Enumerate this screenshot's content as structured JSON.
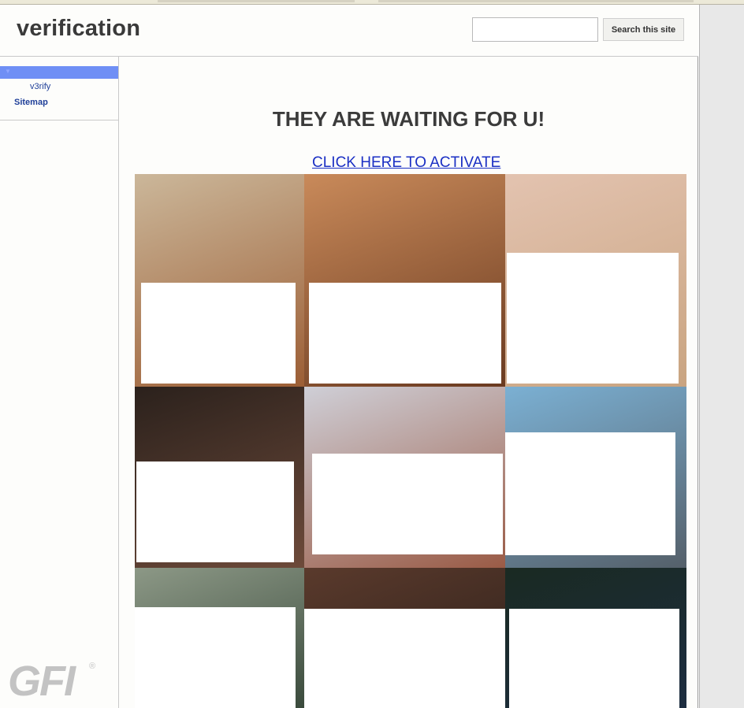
{
  "browser": {
    "tab_hint": ""
  },
  "header": {
    "site_title": "verification",
    "search_placeholder": "",
    "search_button": "Search this site"
  },
  "sidebar": {
    "items": [
      {
        "label": "v3rify"
      },
      {
        "label": "Sitemap"
      }
    ],
    "brand_text": "GFI",
    "brand_mark": "®"
  },
  "main": {
    "headline": "THEY ARE WAITING FOR U!",
    "activate_link": "CLICK HERE TO ACTIVATE"
  },
  "gallery": {
    "tiles": [
      {
        "name": "photo-tile-1",
        "top": "#cbb79a",
        "bottom": "#9c5e35"
      },
      {
        "name": "photo-tile-2",
        "top": "#c98a5a",
        "bottom": "#6a3a20"
      },
      {
        "name": "photo-tile-3",
        "top": "#e3c3b0",
        "bottom": "#c9a480"
      },
      {
        "name": "photo-tile-4",
        "top": "#2b211c",
        "bottom": "#6d4a3a"
      },
      {
        "name": "photo-tile-5",
        "top": "#cfcfd7",
        "bottom": "#9a5b46"
      },
      {
        "name": "photo-tile-6",
        "top": "#7bb0d3",
        "bottom": "#55606a"
      },
      {
        "name": "photo-tile-7",
        "top": "#8c9886",
        "bottom": "#3a4a3c"
      },
      {
        "name": "photo-tile-8",
        "top": "#5a3a2c",
        "bottom": "#2c1f1a"
      },
      {
        "name": "photo-tile-9",
        "top": "#1a2a22",
        "bottom": "#1d2d40"
      }
    ]
  }
}
